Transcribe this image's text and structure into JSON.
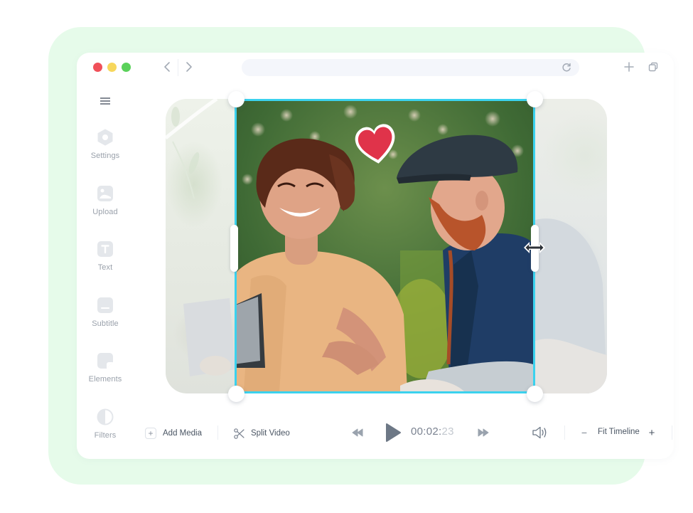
{
  "window": {
    "traffic_lights": [
      "close",
      "minimize",
      "maximize"
    ],
    "nav": {
      "back_icon": "chevron-left-icon",
      "forward_icon": "chevron-right-icon"
    },
    "address_bar": {
      "value": "",
      "reload_icon": "reload-icon"
    },
    "actions": {
      "new_tab_icon": "plus-icon",
      "windows_icon": "windows-stack-icon"
    }
  },
  "sidebar": {
    "menu_icon": "hamburger-menu-icon",
    "items": [
      {
        "label": "Settings",
        "icon": "settings-icon"
      },
      {
        "label": "Upload",
        "icon": "image-upload-icon"
      },
      {
        "label": "Text",
        "icon": "text-icon"
      },
      {
        "label": "Subtitle",
        "icon": "subtitle-icon"
      },
      {
        "label": "Elements",
        "icon": "sticker-icon"
      },
      {
        "label": "Filters",
        "icon": "filter-contrast-icon"
      }
    ]
  },
  "canvas": {
    "selection_color": "#3bd2ee",
    "sticker": "heart-sticker",
    "sticker_color": "#e0334a"
  },
  "toolbar": {
    "add_media_label": "Add Media",
    "split_video_label": "Split Video",
    "timecode_main": "00:02:",
    "timecode_frames": "23",
    "fit_timeline_label": "Fit Timeline",
    "zoom_out_symbol": "−",
    "zoom_in_symbol": "+",
    "add_symbol": "+"
  },
  "colors": {
    "backdrop": "#e6fbea",
    "traffic_red": "#f05059",
    "traffic_yellow": "#f7d75c",
    "traffic_green": "#5ad15a",
    "accent": "#3bd2ee"
  }
}
